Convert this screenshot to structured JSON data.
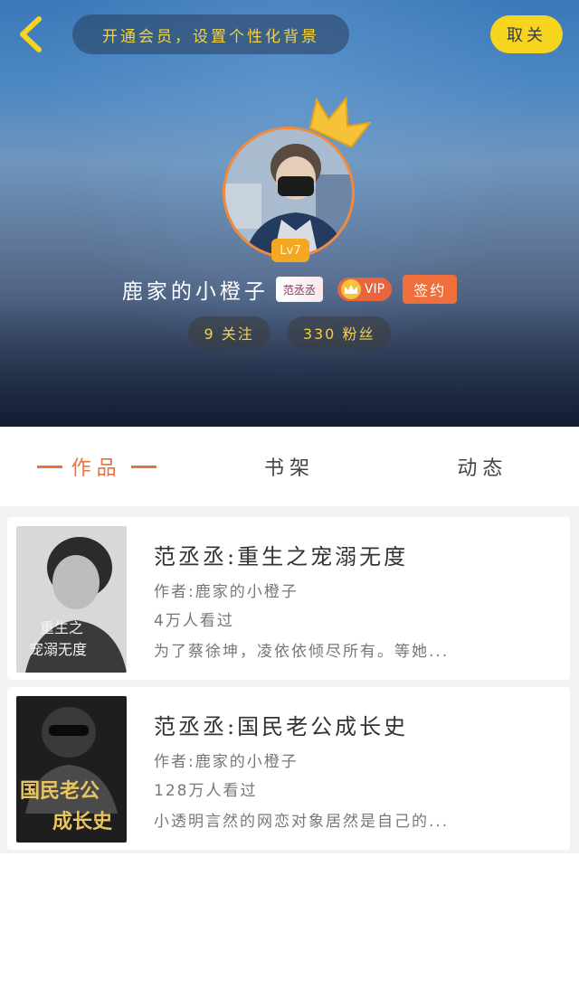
{
  "header": {
    "vip_banner": "开通会员，设置个性化背景",
    "unfollow_label": "取关",
    "level": "Lv7",
    "username": "鹿家的小橙子",
    "tag_label": "范丞丞",
    "vip_label": "VIP",
    "signed_label": "签约",
    "following_label": "9 关注",
    "fans_label": "330 粉丝"
  },
  "tabs": [
    {
      "label": "作品",
      "active": true
    },
    {
      "label": "书架",
      "active": false
    },
    {
      "label": "动态",
      "active": false
    }
  ],
  "books": [
    {
      "title": "范丞丞:重生之宠溺无度",
      "author": "作者:鹿家的小橙子",
      "views": "4万人看过",
      "desc": "为了蔡徐坤，凌依依倾尽所有。等她...",
      "cover_text": "重生之宠溺无度"
    },
    {
      "title": "范丞丞:国民老公成长史",
      "author": "作者:鹿家的小橙子",
      "views": "128万人看过",
      "desc": "小透明言然的网恋对象居然是自己的...",
      "cover_text": "国民老公成长史"
    }
  ],
  "colors": {
    "accent": "#e8733a",
    "vip_yellow": "#f7d51e",
    "banner_text": "#f2d34a"
  },
  "icons": {
    "back": "chevron-left-icon",
    "crown": "crown-icon",
    "vip_coin": "crown-coin-icon"
  }
}
